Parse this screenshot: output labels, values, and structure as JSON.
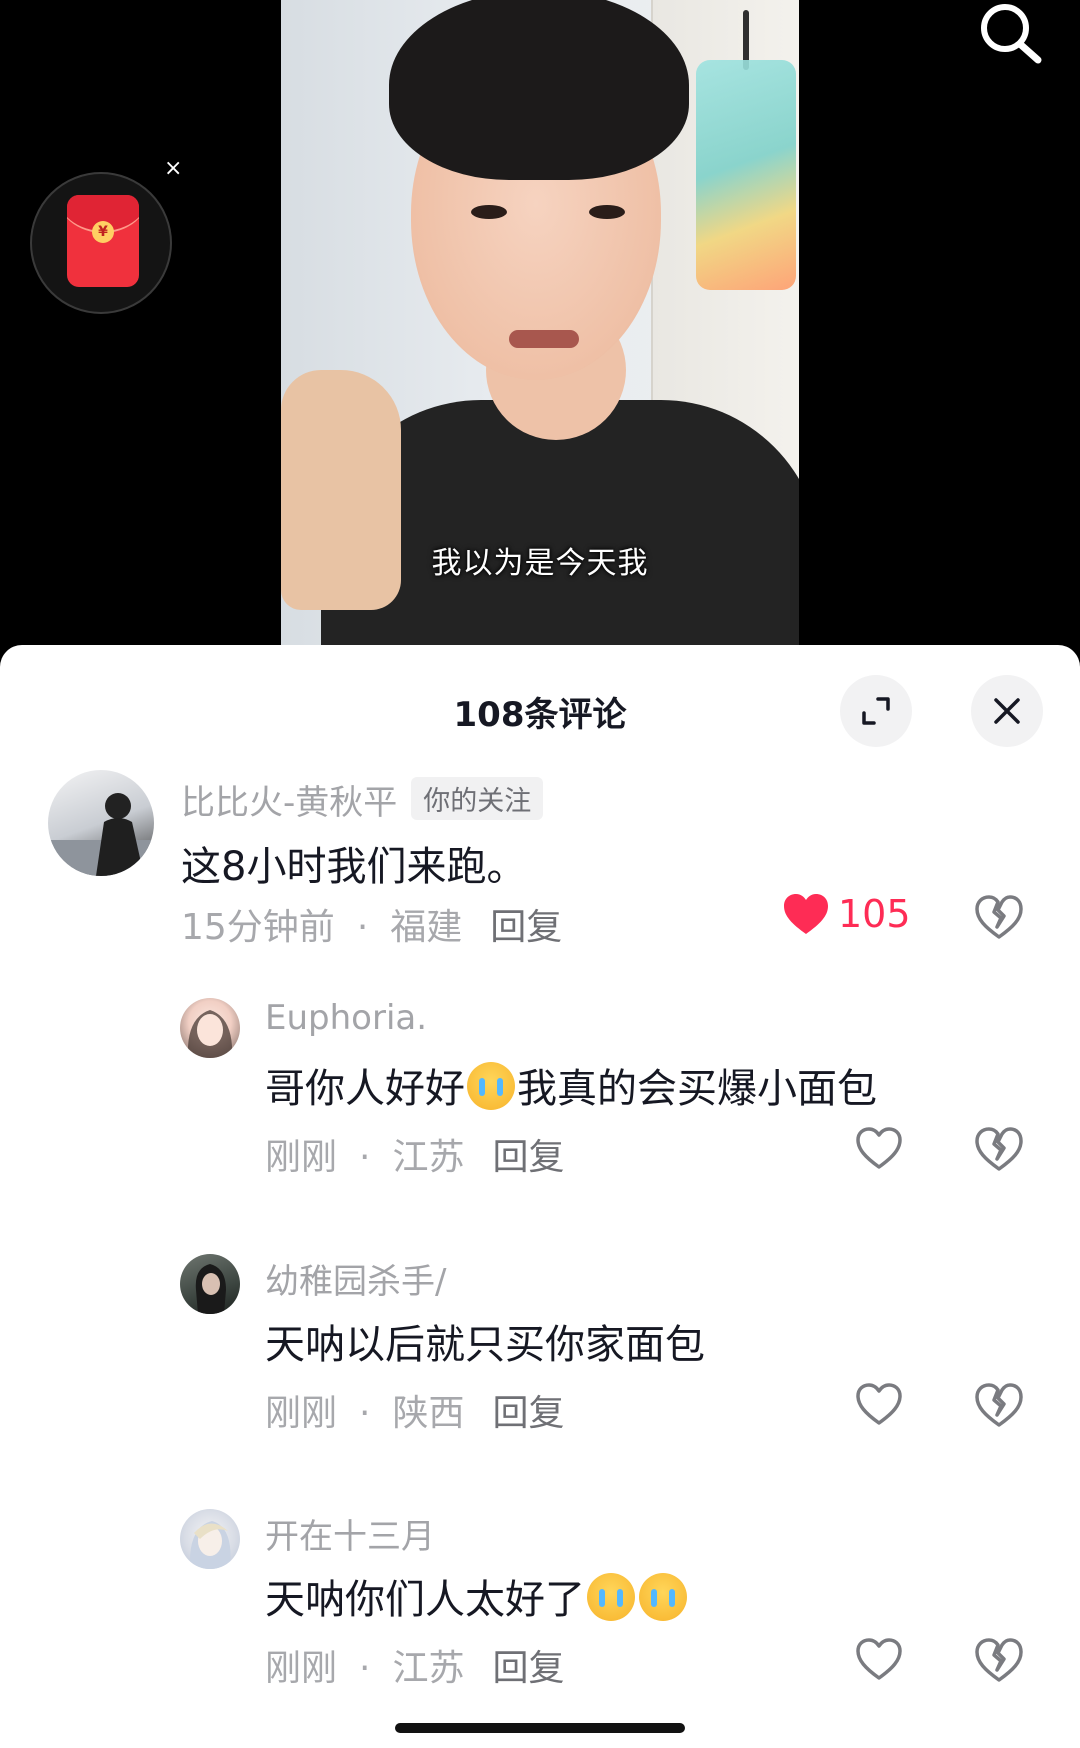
{
  "video": {
    "subtitle": "我以为是今天我"
  },
  "redpacket": {
    "close_label": "×",
    "coin_symbol": "¥"
  },
  "panel": {
    "title": "108条评论"
  },
  "comments": [
    {
      "username": "比比火-黄秋平",
      "tag": "你的关注",
      "text": "这8小时我们来跑。",
      "time": "15分钟前",
      "location": "福建",
      "reply_label": "回复",
      "likes": "105",
      "liked": true
    },
    {
      "username": "Euphoria.",
      "text_before": "哥你人好好",
      "text_after": "我真的会买爆小面包",
      "time": "刚刚",
      "location": "江苏",
      "reply_label": "回复",
      "liked": false
    },
    {
      "username": "幼稚园杀手/",
      "text": "天呐以后就只买你家面包",
      "time": "刚刚",
      "location": "陕西",
      "reply_label": "回复",
      "liked": false
    },
    {
      "username": "开在十三月",
      "text_before": "天呐你们人太好了",
      "time": "刚刚",
      "location": "江苏",
      "reply_label": "回复",
      "liked": false
    }
  ],
  "meta_separator": "·",
  "colors": {
    "like_red": "#fe2c55",
    "redpacket": "#f0313d",
    "text_primary": "#161823",
    "text_secondary": "#a3a4a8"
  }
}
